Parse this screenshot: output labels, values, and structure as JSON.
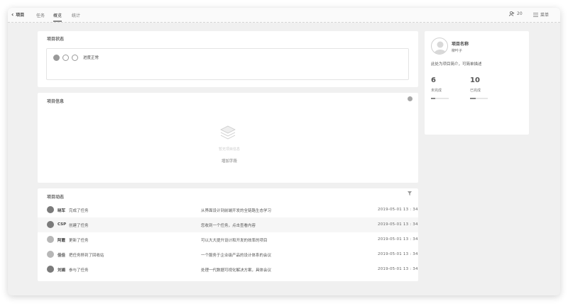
{
  "topbar": {
    "back_label": "项目",
    "tabs": [
      {
        "label": "任务",
        "active": false
      },
      {
        "label": "概览",
        "active": true
      },
      {
        "label": "统计",
        "active": false
      }
    ],
    "member_count": "20",
    "menu_label": "菜单"
  },
  "status_card": {
    "title": "项目状态",
    "steps_total": 3,
    "steps_done": 1,
    "current_status": "进度正常"
  },
  "info_card": {
    "title": "项目信息",
    "empty_text": "暂无项目信息",
    "add_field_label": "增加字段"
  },
  "activity_card": {
    "title": "项目动态",
    "rows": [
      {
        "user": "晓军",
        "action": "完成了任务",
        "desc": "从界面设计到前端开发的全链路生态学习",
        "time": "2019-05-01  13 : 34",
        "avatar": "dark",
        "highlight": false
      },
      {
        "user": "CSP",
        "action": "创建了任务",
        "desc": "您收到一个任务，点击查看内容",
        "time": "2019-05-01  13 : 34",
        "avatar": "dark",
        "highlight": true
      },
      {
        "user": "阿霞",
        "action": "更新了任务",
        "desc": "可以大大提升设计和开发的效率的项目",
        "time": "2019-05-01  13 : 34",
        "avatar": "light",
        "highlight": false
      },
      {
        "user": "佳佳",
        "action": "把任务移到了回收站",
        "desc": "一个服务于企业级产品的设计体系的会议",
        "time": "2019-05-01  13 : 34",
        "avatar": "light",
        "highlight": false
      },
      {
        "user": "刘娟",
        "action": "参与了任务",
        "desc": "处理一代数据可视化解决方案，具体会议",
        "time": "2019-05-01  13 : 34",
        "avatar": "dark",
        "highlight": false
      }
    ]
  },
  "profile_card": {
    "project_name": "项目名称",
    "owner": "柳叶子",
    "intro": "此处为项目简介，可简单描述",
    "stats": [
      {
        "value": "6",
        "label": "未完成",
        "progress": 0.25
      },
      {
        "value": "10",
        "label": "已完成",
        "progress": 0.3
      }
    ]
  },
  "colors": {
    "background": "#f0f0f0",
    "card": "#ffffff",
    "accent": "#888888"
  }
}
